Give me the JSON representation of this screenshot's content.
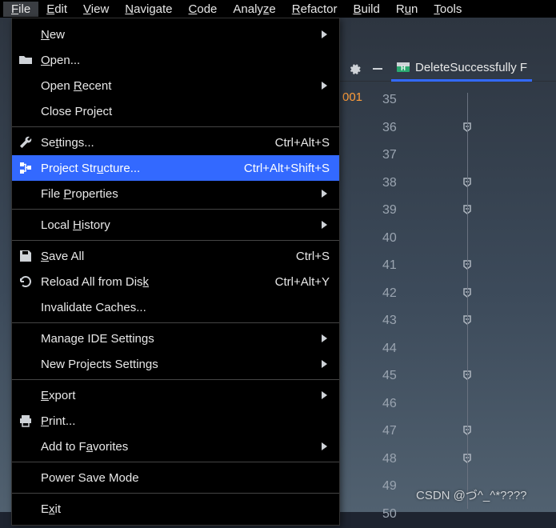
{
  "menubar": {
    "items": [
      {
        "pre": "",
        "m": "F",
        "post": "ile",
        "active": true
      },
      {
        "pre": "",
        "m": "E",
        "post": "dit"
      },
      {
        "pre": "",
        "m": "V",
        "post": "iew"
      },
      {
        "pre": "",
        "m": "N",
        "post": "avigate"
      },
      {
        "pre": "",
        "m": "C",
        "post": "ode"
      },
      {
        "pre": "Analy",
        "m": "z",
        "post": "e"
      },
      {
        "pre": "",
        "m": "R",
        "post": "efactor"
      },
      {
        "pre": "",
        "m": "B",
        "post": "uild"
      },
      {
        "pre": "R",
        "m": "u",
        "post": "n"
      },
      {
        "pre": "",
        "m": "T",
        "post": "ools"
      }
    ]
  },
  "file_menu": [
    {
      "type": "item",
      "icon": "",
      "pre": "",
      "m": "N",
      "post": "ew",
      "shortcut": "",
      "sub": true
    },
    {
      "type": "item",
      "icon": "folder",
      "pre": "",
      "m": "O",
      "post": "pen...",
      "shortcut": ""
    },
    {
      "type": "item",
      "icon": "",
      "pre": "Open ",
      "m": "R",
      "post": "ecent",
      "shortcut": "",
      "sub": true
    },
    {
      "type": "item",
      "icon": "",
      "pre": "Close Pro",
      "m": "j",
      "post": "ect",
      "shortcut": ""
    },
    {
      "type": "sep"
    },
    {
      "type": "item",
      "icon": "wrench",
      "pre": "Se",
      "m": "t",
      "post": "tings...",
      "shortcut": "Ctrl+Alt+S"
    },
    {
      "type": "item",
      "icon": "structure",
      "pre": "Project Str",
      "m": "u",
      "post": "cture...",
      "shortcut": "Ctrl+Alt+Shift+S",
      "selected": true
    },
    {
      "type": "item",
      "icon": "",
      "pre": "File ",
      "m": "P",
      "post": "roperties",
      "shortcut": "",
      "sub": true
    },
    {
      "type": "sep"
    },
    {
      "type": "item",
      "icon": "",
      "pre": "Local ",
      "m": "H",
      "post": "istory",
      "shortcut": "",
      "sub": true
    },
    {
      "type": "sep"
    },
    {
      "type": "item",
      "icon": "save",
      "pre": "",
      "m": "S",
      "post": "ave All",
      "shortcut": "Ctrl+S"
    },
    {
      "type": "item",
      "icon": "reload",
      "pre": "Reload All from Dis",
      "m": "k",
      "post": "",
      "shortcut": "Ctrl+Alt+Y"
    },
    {
      "type": "item",
      "icon": "",
      "pre": "Invalidate Caches...",
      "m": "",
      "post": "",
      "shortcut": ""
    },
    {
      "type": "sep"
    },
    {
      "type": "item",
      "icon": "",
      "pre": "Manage IDE Settings",
      "m": "",
      "post": "",
      "shortcut": "",
      "sub": true
    },
    {
      "type": "item",
      "icon": "",
      "pre": "New Projects Settings",
      "m": "",
      "post": "",
      "shortcut": "",
      "sub": true
    },
    {
      "type": "sep"
    },
    {
      "type": "item",
      "icon": "",
      "pre": "",
      "m": "E",
      "post": "xport",
      "shortcut": "",
      "sub": true
    },
    {
      "type": "item",
      "icon": "print",
      "pre": "",
      "m": "P",
      "post": "rint...",
      "shortcut": ""
    },
    {
      "type": "item",
      "icon": "",
      "pre": "Add to F",
      "m": "a",
      "post": "vorites",
      "shortcut": "",
      "sub": true
    },
    {
      "type": "sep"
    },
    {
      "type": "item",
      "icon": "",
      "pre": "Power Save Mode",
      "m": "",
      "post": "",
      "shortcut": ""
    },
    {
      "type": "sep"
    },
    {
      "type": "item",
      "icon": "",
      "pre": "E",
      "m": "x",
      "post": "it",
      "shortcut": ""
    }
  ],
  "tab": {
    "name": "DeleteSuccessfully F"
  },
  "orange_number": "001",
  "gutter": {
    "start": 35,
    "end": 50,
    "folds": [
      36,
      38,
      39,
      41,
      42,
      43,
      45,
      47,
      48
    ]
  },
  "watermark": "CSDN @づ^_^*????"
}
